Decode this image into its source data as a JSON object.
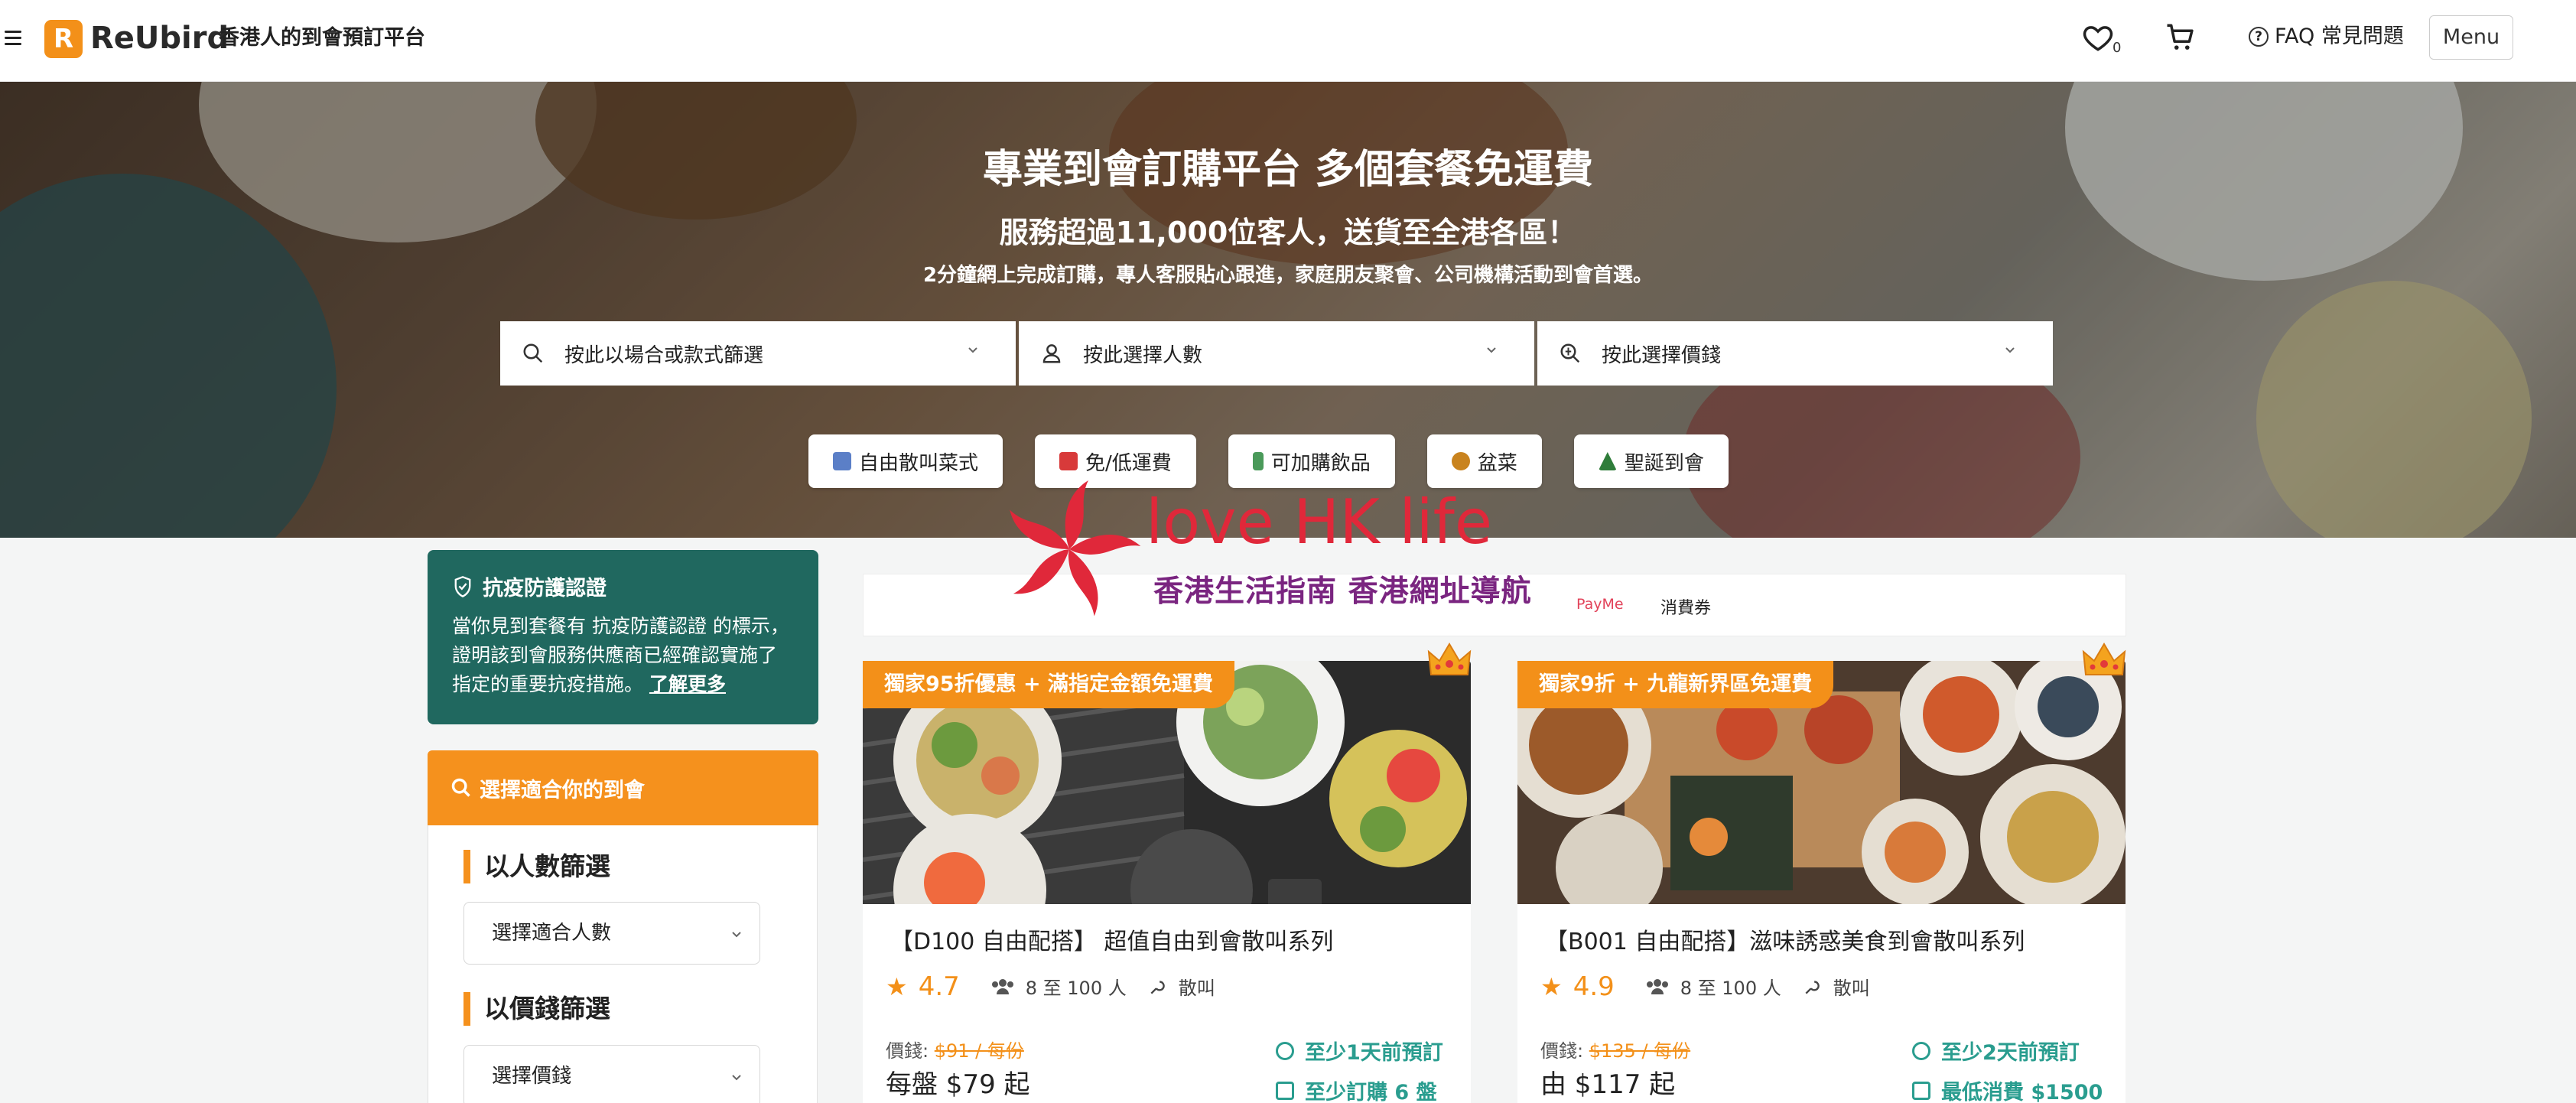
{
  "header": {
    "logo_letter": "R",
    "logo_text": "ReUbird",
    "tagline": "香港人的到會預訂平台",
    "wishlist_count": "0",
    "faq_label": "FAQ 常見問題",
    "menu_label": "Menu"
  },
  "hero": {
    "title": "專業到會訂購平台 多個套餐免運費",
    "subtitle": "服務超過11,000位客人，送貨至全港各區！",
    "description": "2分鐘網上完成訂購，專人客服貼心跟進，家庭朋友聚會、公司機構活動到會首選。",
    "filters": [
      {
        "label": "按此以場合或款式篩選",
        "icon": "search-icon"
      },
      {
        "label": "按此選擇人數",
        "icon": "person-icon"
      },
      {
        "label": "按此選擇價錢",
        "icon": "price-search-icon"
      }
    ],
    "chips": [
      {
        "label": "自由散叫菜式",
        "icon": "free-icon"
      },
      {
        "label": "免/低運費",
        "icon": "truck-icon"
      },
      {
        "label": "可加購飲品",
        "icon": "drink-icon"
      },
      {
        "label": "盆菜",
        "icon": "pot-icon"
      },
      {
        "label": "聖誕到會",
        "icon": "tree-icon"
      }
    ]
  },
  "sidebar": {
    "card_title": "抗疫防護認證",
    "card_body": "當你見到套餐有 抗疫防護認證 的標示，證明該到會服務供應商已經確認實施了指定的重要抗疫措施。",
    "card_link": "了解更多",
    "finder_title": "選擇適合你的到會",
    "section_people": "以人數篩選",
    "select_people": "選擇適合人數",
    "section_price": "以價錢篩選",
    "select_price": "選擇價錢"
  },
  "promo": {
    "payme": "PayMe",
    "voucher": "消費券"
  },
  "watermark": {
    "line1": "love HK life",
    "line2": "香港生活指南 香港網址導航"
  },
  "cards": [
    {
      "badge": "獨家95折優惠 + 滿指定金額免運費",
      "title": "【D100 自由配搭】 超值自由到會散叫系列",
      "rating": "4.7",
      "people": "8 至 100 人",
      "style": "散叫",
      "price_label": "價錢:",
      "old_price": "$91 / 每份",
      "price": "每盤 $79 起",
      "info1": "至少1天前預訂",
      "info2": "至少訂購 6 盤"
    },
    {
      "badge": "獨家9折 + 九龍新界區免運費",
      "title": "【B001 自由配搭】滋味誘惑美食到會散叫系列",
      "rating": "4.9",
      "people": "8 至 100 人",
      "style": "散叫",
      "price_label": "價錢:",
      "old_price": "$135 / 每份",
      "price": "由 $117 起",
      "info1": "至少2天前預訂",
      "info2": "最低消費 $1500"
    }
  ]
}
